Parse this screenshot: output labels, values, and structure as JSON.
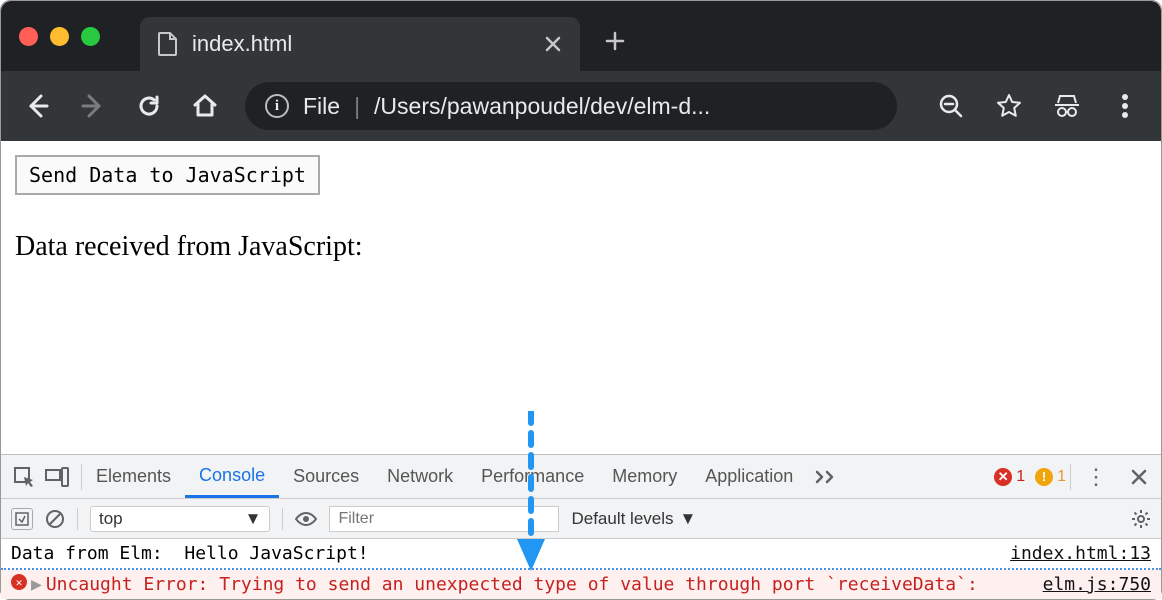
{
  "tab": {
    "title": "index.html"
  },
  "omnibox": {
    "scheme": "File",
    "path": "/Users/pawanpoudel/dev/elm-d..."
  },
  "page": {
    "button_label": "Send Data to JavaScript",
    "body_text": "Data received from JavaScript:"
  },
  "devtools": {
    "panes": [
      "Elements",
      "Console",
      "Sources",
      "Network",
      "Performance",
      "Memory",
      "Application"
    ],
    "active_pane": "Console",
    "errors": "1",
    "warnings": "1",
    "filter_placeholder": "Filter",
    "context": "top",
    "levels": "Default levels",
    "log1_msg": "Data from Elm:  Hello JavaScript!",
    "log1_src": "index.html:13",
    "log2_msg": "Uncaught Error: Trying to send an unexpected type of value through port `receiveData`:",
    "log2_src": "elm.js:750"
  }
}
